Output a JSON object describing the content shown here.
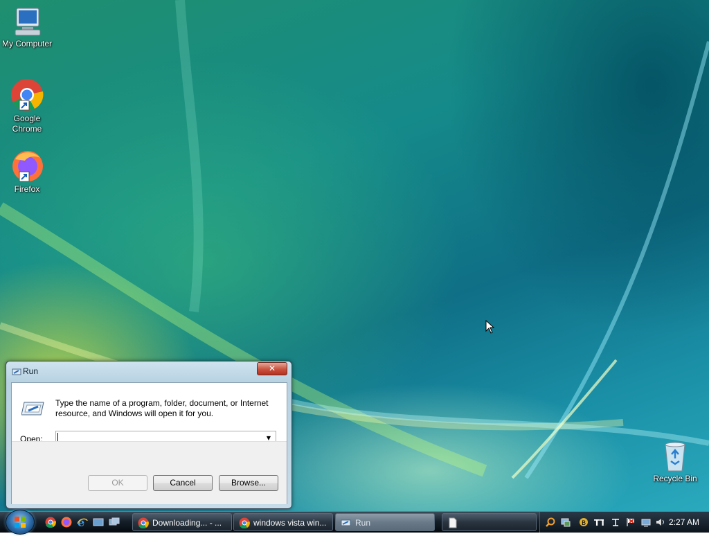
{
  "desktop": {
    "icons": [
      {
        "label": "My Computer",
        "icon": "computer-icon"
      },
      {
        "label": "Google Chrome",
        "icon": "chrome-icon"
      },
      {
        "label": "Firefox",
        "icon": "firefox-icon"
      },
      {
        "label": "Recycle Bin",
        "icon": "recycle-bin-icon"
      }
    ]
  },
  "run_dialog": {
    "title": "Run",
    "close_label": "✕",
    "description": "Type the name of a program, folder, document, or Internet resource, and Windows will open it for you.",
    "open_label": "Open:",
    "open_value": "",
    "ok_label": "OK",
    "cancel_label": "Cancel",
    "browse_label": "Browse..."
  },
  "taskbar": {
    "quick_launch": [
      "chrome-icon",
      "firefox-icon",
      "internet-explorer-icon",
      "show-desktop-icon",
      "switch-windows-icon"
    ],
    "tasks": [
      {
        "label": "Downloading... - ...",
        "icon": "chrome-icon"
      },
      {
        "label": "windows vista win...",
        "icon": "chrome-icon"
      },
      {
        "label": "Run",
        "icon": "run-icon"
      },
      {
        "label": "",
        "icon": "document-icon"
      }
    ],
    "tray_icons": [
      "search-icon",
      "network-status-icon",
      "security-icon",
      "text-icon",
      "network-icon",
      "flag-icon",
      "connection-icon",
      "volume-icon"
    ],
    "clock": "2:27 AM"
  },
  "colors": {
    "close_button": "#c8533f",
    "taskbar": "#15202b",
    "dialog_frame": "#b8d2e2"
  }
}
